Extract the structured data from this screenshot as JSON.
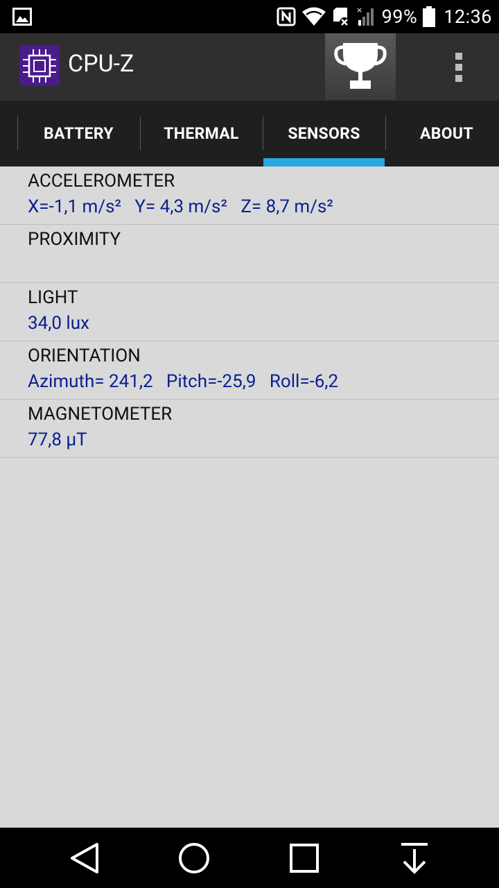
{
  "status_bar": {
    "battery_percent": "99%",
    "time": "12:36",
    "icons": [
      "gallery-icon",
      "nfc-icon",
      "wifi-icon",
      "sd-card-icon",
      "signal-icon",
      "battery-icon"
    ]
  },
  "app_bar": {
    "title": "CPU-Z",
    "icons": [
      "cpu-logo-icon",
      "trophy-icon",
      "overflow-menu-icon"
    ]
  },
  "tabs": [
    {
      "label": "BATTERY"
    },
    {
      "label": "THERMAL"
    },
    {
      "label": "SENSORS",
      "selected": true
    },
    {
      "label": "ABOUT"
    }
  ],
  "sensors": [
    {
      "title": "ACCELEROMETER",
      "value": "X=-1,1 m/s²   Y= 4,3 m/s²   Z= 8,7 m/s²"
    },
    {
      "title": "PROXIMITY",
      "value": ""
    },
    {
      "title": "LIGHT",
      "value": "34,0 lux"
    },
    {
      "title": "ORIENTATION",
      "value": "Azimuth= 241,2   Pitch=-25,9   Roll=-6,2"
    },
    {
      "title": "MAGNETOMETER",
      "value": "77,8 µT"
    }
  ],
  "nav_bar": {
    "icons": [
      "back-icon",
      "home-icon",
      "recents-icon",
      "notification-pull-icon"
    ]
  },
  "colors": {
    "tab_indicator": "#29a7df",
    "value_text": "#0a1f8f",
    "app_bar": "#2f2f2f",
    "tab_bar": "#1f1f1f",
    "content_bg": "#d9d9d9"
  }
}
